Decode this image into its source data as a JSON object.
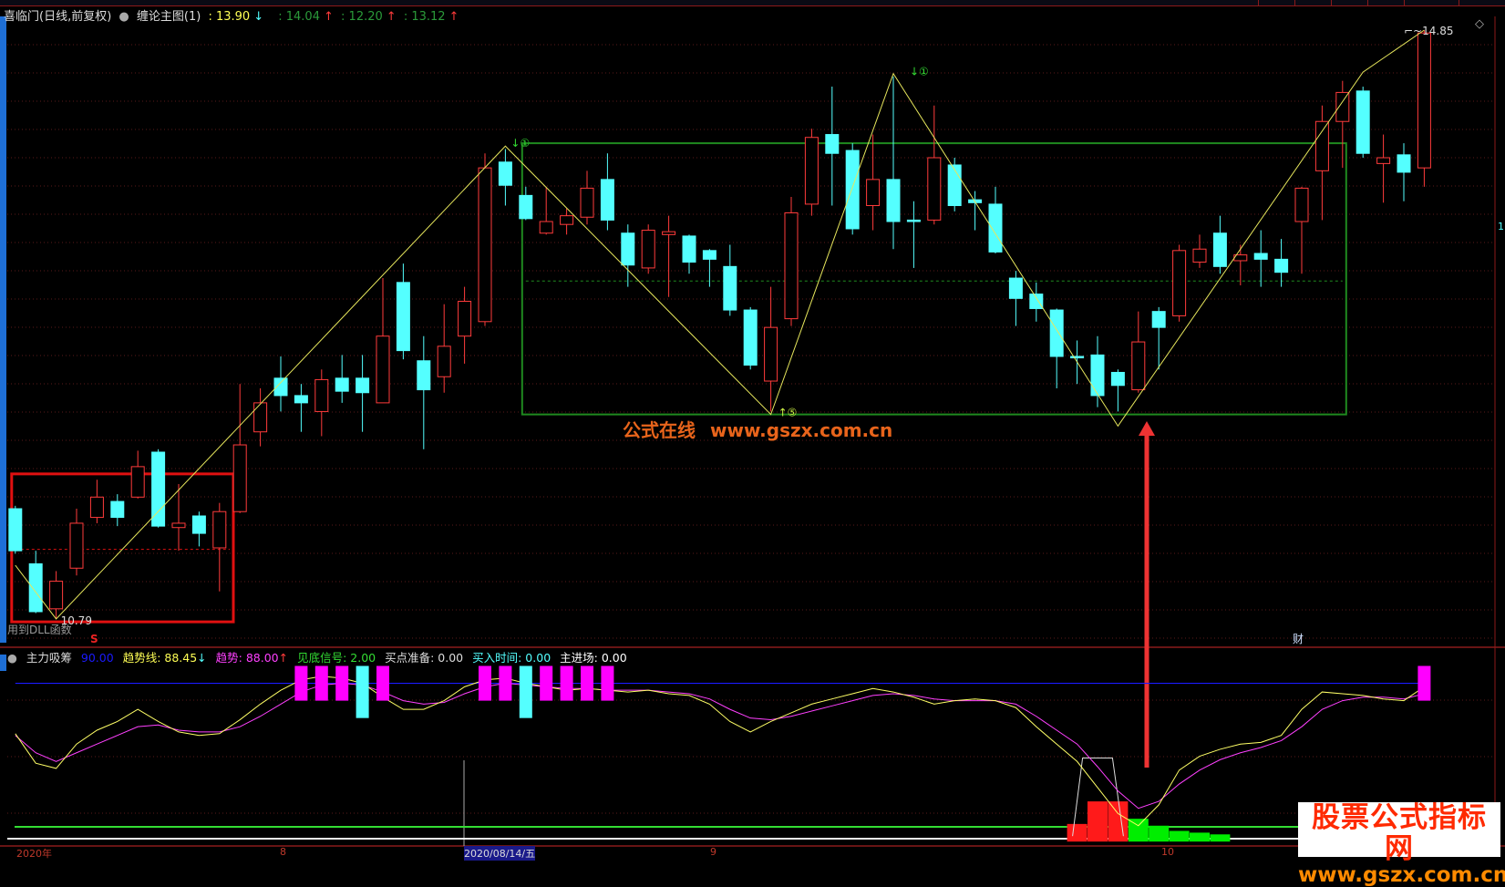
{
  "header": {
    "stock": "喜临门(日线,前复权)",
    "indicator": "缠论主图(1)",
    "v1": ": 13.90",
    "v1_arrow": "↓",
    "v2": ": 14.04",
    "v3": ": 12.20",
    "v4": ": 13.12",
    "up_arrow": "↑",
    "high_label": "14.85",
    "low_label": "10.79",
    "dll_note": "用到DLL函数",
    "s_marker": "S",
    "cai_marker": "财",
    "marker_top1": "↓①",
    "marker_top2": "↓①",
    "marker_bottom": "↑⑤",
    "right_cut": "1"
  },
  "subpane": {
    "name": "主力吸筹",
    "val": "90.00",
    "trendline_label": "趋势线: 88.45",
    "trendline_arrow": "↓",
    "trend_label": "趋势: 88.00",
    "trend_arrow": "↑",
    "bottom_signal": "见底信号: 2.00",
    "buy_prepare": "买点准备: 0.00",
    "buy_time": "买入时间: 0.00",
    "main_entry": "主进场: 0.00"
  },
  "time_axis": [
    "2020年",
    "8",
    "2020/08/14/五",
    "9",
    "10"
  ],
  "watermark": {
    "center_cn": "公式在线",
    "center_url": "www.gszx.com.cn",
    "corner_cn": "股票公式指标网",
    "corner_url": "www.gszx.com.cn"
  },
  "colors": {
    "up": "#ff3b3b",
    "down": "#54ffff",
    "zigzag": "#e6e65c",
    "box_green": "#1f8a1f",
    "box_red": "#e01010",
    "trend_yellow": "#ffff66",
    "trend_magenta": "#ff40ff",
    "bar_magenta": "#ff00ff",
    "level_blue": "#1a1aff"
  },
  "chart_data": {
    "type": "candlestick",
    "title": "喜临门(日线,前复权) 缠论主图",
    "ylim": [
      10.7,
      14.9
    ],
    "candles": [
      [
        11.55,
        11.57,
        11.24,
        11.26
      ],
      [
        11.17,
        11.26,
        10.83,
        10.84
      ],
      [
        10.86,
        11.12,
        10.79,
        11.05
      ],
      [
        11.14,
        11.55,
        11.09,
        11.45
      ],
      [
        11.49,
        11.75,
        11.45,
        11.63
      ],
      [
        11.6,
        11.65,
        11.43,
        11.49
      ],
      [
        11.63,
        11.95,
        11.62,
        11.84
      ],
      [
        11.94,
        11.96,
        11.42,
        11.43
      ],
      [
        11.42,
        11.72,
        11.26,
        11.45
      ],
      [
        11.5,
        11.53,
        11.29,
        11.38
      ],
      [
        11.28,
        11.59,
        10.98,
        11.53
      ],
      [
        11.53,
        12.41,
        11.52,
        11.99
      ],
      [
        12.08,
        12.38,
        11.98,
        12.28
      ],
      [
        12.45,
        12.6,
        12.22,
        12.33
      ],
      [
        12.33,
        12.41,
        12.08,
        12.28
      ],
      [
        12.22,
        12.51,
        12.05,
        12.44
      ],
      [
        12.45,
        12.61,
        12.28,
        12.36
      ],
      [
        12.45,
        12.61,
        12.08,
        12.35
      ],
      [
        12.28,
        13.14,
        12.28,
        12.74
      ],
      [
        13.11,
        13.24,
        12.58,
        12.64
      ],
      [
        12.57,
        12.74,
        11.96,
        12.37
      ],
      [
        12.46,
        12.96,
        12.35,
        12.67
      ],
      [
        12.74,
        13.08,
        12.55,
        12.98
      ],
      [
        12.84,
        14.0,
        12.81,
        13.9
      ],
      [
        13.94,
        14.03,
        13.64,
        13.78
      ],
      [
        13.71,
        13.77,
        13.54,
        13.55
      ],
      [
        13.45,
        13.77,
        13.44,
        13.53
      ],
      [
        13.51,
        13.62,
        13.44,
        13.57
      ],
      [
        13.56,
        13.88,
        13.51,
        13.76
      ],
      [
        13.82,
        14.0,
        13.47,
        13.54
      ],
      [
        13.45,
        13.51,
        13.08,
        13.23
      ],
      [
        13.21,
        13.51,
        13.17,
        13.47
      ],
      [
        13.44,
        13.57,
        13.01,
        13.46
      ],
      [
        13.43,
        13.44,
        13.17,
        13.25
      ],
      [
        13.33,
        13.34,
        13.08,
        13.27
      ],
      [
        13.22,
        13.37,
        12.88,
        12.92
      ],
      [
        12.92,
        12.94,
        12.51,
        12.54
      ],
      [
        12.43,
        13.08,
        12.22,
        12.8
      ],
      [
        12.86,
        13.7,
        12.81,
        13.59
      ],
      [
        13.65,
        14.17,
        13.57,
        14.11
      ],
      [
        14.13,
        14.46,
        13.64,
        14.0
      ],
      [
        14.02,
        14.07,
        13.44,
        13.48
      ],
      [
        13.64,
        14.13,
        13.47,
        13.82
      ],
      [
        13.82,
        14.53,
        13.34,
        13.53
      ],
      [
        13.54,
        13.67,
        13.21,
        13.53
      ],
      [
        13.54,
        14.33,
        13.51,
        13.97
      ],
      [
        13.92,
        13.97,
        13.6,
        13.64
      ],
      [
        13.68,
        13.74,
        13.47,
        13.66
      ],
      [
        13.65,
        13.77,
        13.31,
        13.32
      ],
      [
        13.14,
        13.19,
        12.81,
        13.0
      ],
      [
        13.03,
        13.11,
        12.84,
        12.93
      ],
      [
        12.92,
        12.93,
        12.38,
        12.6
      ],
      [
        12.6,
        12.71,
        12.41,
        12.59
      ],
      [
        12.61,
        12.74,
        12.25,
        12.33
      ],
      [
        12.49,
        12.51,
        12.22,
        12.4
      ],
      [
        12.37,
        12.91,
        12.35,
        12.7
      ],
      [
        12.91,
        12.94,
        12.51,
        12.8
      ],
      [
        12.88,
        13.37,
        12.84,
        13.33
      ],
      [
        13.25,
        13.44,
        13.21,
        13.34
      ],
      [
        13.45,
        13.57,
        13.17,
        13.22
      ],
      [
        13.26,
        13.37,
        13.09,
        13.3
      ],
      [
        13.31,
        13.47,
        13.08,
        13.27
      ],
      [
        13.27,
        13.41,
        13.08,
        13.18
      ],
      [
        13.53,
        13.77,
        13.17,
        13.76
      ],
      [
        13.88,
        14.33,
        13.54,
        14.22
      ],
      [
        14.22,
        14.5,
        13.9,
        14.42
      ],
      [
        14.43,
        14.46,
        13.97,
        14.0
      ],
      [
        13.93,
        14.13,
        13.66,
        13.97
      ],
      [
        13.99,
        14.07,
        13.67,
        13.87
      ],
      [
        13.9,
        14.85,
        13.77,
        14.83
      ]
    ],
    "candle_fields": [
      "open",
      "high",
      "low",
      "close"
    ],
    "zigzag": [
      [
        0,
        11.16
      ],
      [
        2,
        10.79
      ],
      [
        24,
        14.05
      ],
      [
        37,
        12.2
      ],
      [
        43,
        14.55
      ],
      [
        54,
        12.12
      ],
      [
        66,
        14.56
      ]
    ],
    "boxes": [
      {
        "name": "green-box",
        "from": 25,
        "to": 65,
        "top": 14.07,
        "bottom": 12.2,
        "mid": 13.12
      },
      {
        "name": "red-box",
        "from": 0,
        "to": 10.5,
        "top": 11.79,
        "bottom": 10.77,
        "mid": 11.27
      }
    ],
    "sub": {
      "ylim": [
        0,
        100
      ],
      "level": 90,
      "trendline": [
        61,
        44,
        41,
        55,
        63,
        68,
        75,
        68,
        62,
        60,
        61,
        69,
        78,
        86,
        92,
        94,
        93,
        90,
        82,
        75,
        75,
        80,
        88,
        92,
        93,
        90,
        88,
        86,
        87,
        86,
        85,
        86,
        84,
        83,
        78,
        68,
        62,
        68,
        73,
        78,
        81,
        84,
        87,
        85,
        82,
        78,
        80,
        81,
        80,
        76,
        65,
        55,
        45,
        30,
        15,
        8,
        20,
        40,
        48,
        52,
        55,
        56,
        60,
        75,
        85,
        84,
        83,
        81,
        80,
        88
      ],
      "trend": [
        60,
        50,
        45,
        50,
        55,
        60,
        65,
        66,
        63,
        62,
        62,
        65,
        71,
        78,
        85,
        89,
        90,
        89,
        85,
        80,
        78,
        79,
        84,
        88,
        90,
        89,
        88,
        87,
        87,
        86,
        86,
        86,
        85,
        84,
        81,
        75,
        70,
        69,
        71,
        74,
        77,
        80,
        83,
        84,
        83,
        81,
        80,
        80,
        80,
        78,
        71,
        63,
        55,
        42,
        28,
        18,
        22,
        32,
        40,
        46,
        50,
        53,
        57,
        65,
        75,
        80,
        82,
        82,
        81,
        84
      ],
      "signal_bars": [
        [
          14,
          "m"
        ],
        [
          15,
          "m"
        ],
        [
          16,
          "m"
        ],
        [
          17,
          "c"
        ],
        [
          18,
          "m"
        ],
        [
          23,
          "m"
        ],
        [
          24,
          "m"
        ],
        [
          25,
          "c"
        ],
        [
          26,
          "m"
        ],
        [
          27,
          "m"
        ],
        [
          28,
          "m"
        ],
        [
          29,
          "m"
        ],
        [
          69,
          "m"
        ]
      ],
      "red_hist": [
        [
          52,
          7
        ],
        [
          53,
          20
        ],
        [
          54,
          20
        ]
      ],
      "green_hist": [
        [
          55,
          10
        ],
        [
          56,
          6
        ],
        [
          57,
          3
        ],
        [
          58,
          2
        ],
        [
          59,
          1
        ]
      ]
    }
  }
}
